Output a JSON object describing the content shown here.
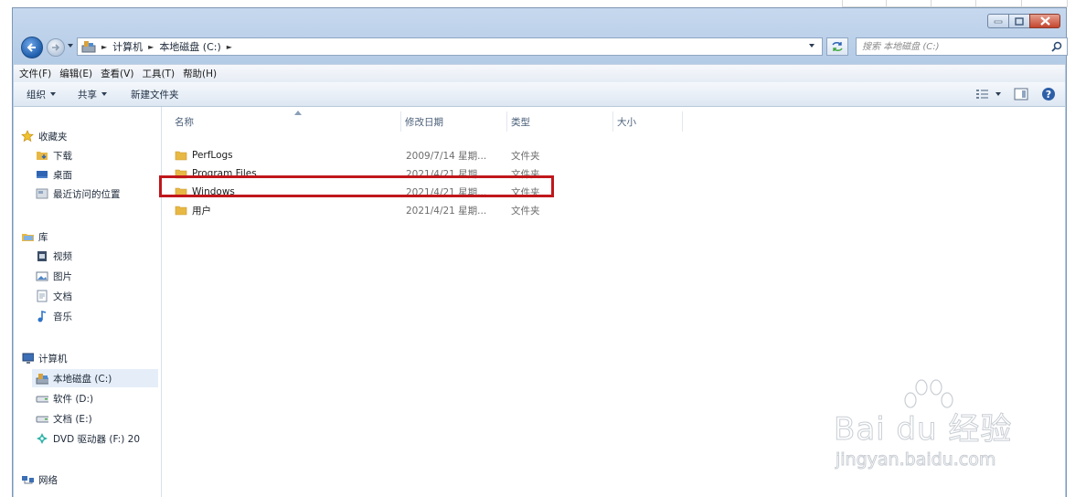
{
  "address": {
    "crumbs": [
      "计算机",
      "本地磁盘 (C:)"
    ]
  },
  "search": {
    "placeholder": "搜索 本地磁盘 (C:)"
  },
  "menu": [
    "文件(F)",
    "编辑(E)",
    "查看(V)",
    "工具(T)",
    "帮助(H)"
  ],
  "toolbar": {
    "organize": "组织",
    "share": "共享",
    "new_folder": "新建文件夹"
  },
  "sidebar": {
    "favorites": "收藏夹",
    "favorites_items": [
      "下载",
      "桌面",
      "最近访问的位置"
    ],
    "libraries": "库",
    "libraries_items": [
      "视频",
      "图片",
      "文档",
      "音乐"
    ],
    "computer": "计算机",
    "computer_items": [
      "本地磁盘 (C:)",
      "软件 (D:)",
      "文档 (E:)",
      "DVD 驱动器 (F:) 20"
    ],
    "network": "网络"
  },
  "columns": {
    "name": "名称",
    "date": "修改日期",
    "type": "类型",
    "size": "大小"
  },
  "files": [
    {
      "name": "PerfLogs",
      "date": "2009/7/14 星期...",
      "type": "文件夹"
    },
    {
      "name": "Program Files",
      "date": "2021/4/21 星期...",
      "type": "文件夹"
    },
    {
      "name": "Windows",
      "date": "2021/4/21 星期...",
      "type": "文件夹"
    },
    {
      "name": "用户",
      "date": "2021/4/21 星期...",
      "type": "文件夹"
    }
  ],
  "highlighted_file": "Windows",
  "watermark": {
    "brand": "Bai du 经验",
    "url": "jingyan.baidu.com"
  },
  "colors": {
    "highlight_box": "#c0171b",
    "folder": "#e8b845",
    "chrome": "#c6d8ee"
  }
}
